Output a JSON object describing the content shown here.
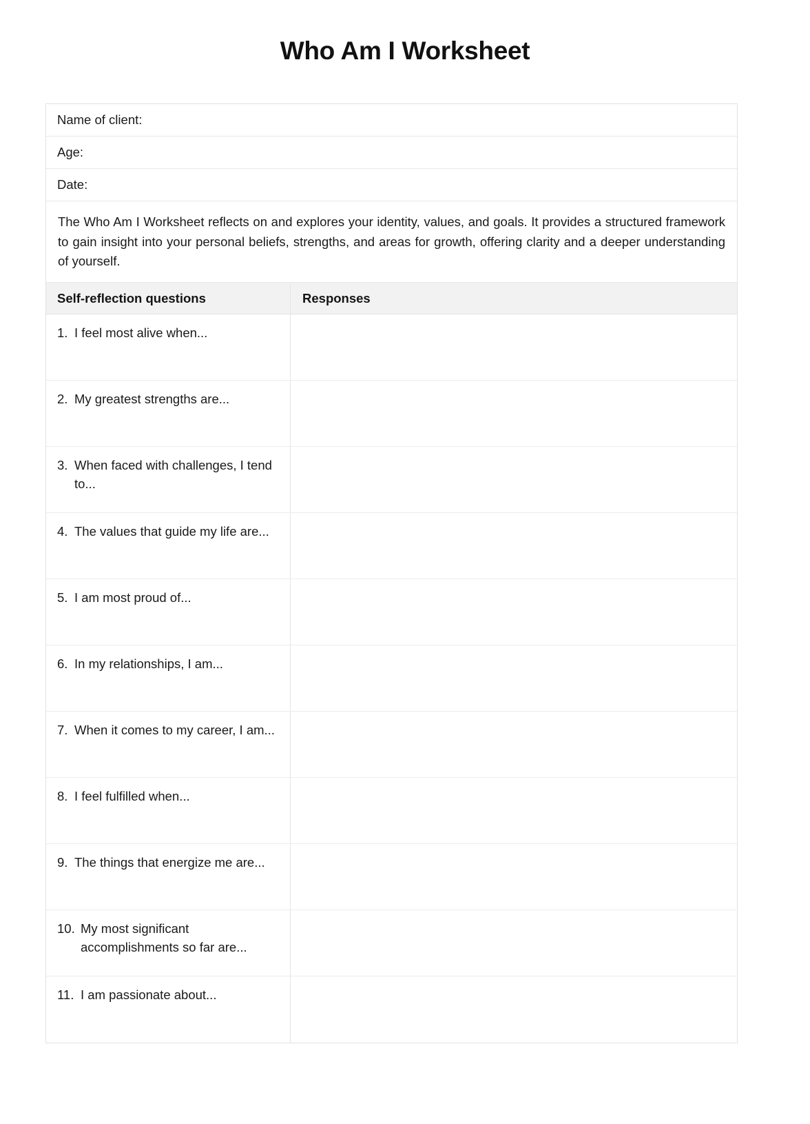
{
  "document": {
    "title": "Who Am I Worksheet"
  },
  "meta_fields": [
    {
      "label": "Name of client:",
      "value": ""
    },
    {
      "label": "Age:",
      "value": ""
    },
    {
      "label": "Date:",
      "value": ""
    }
  ],
  "intro": {
    "text": "The Who Am I Worksheet reflects on and explores your identity, values, and goals. It provides a structured framework to gain insight into your personal beliefs, strengths, and areas for growth, offering clarity and a deeper understanding of yourself."
  },
  "table": {
    "headers": {
      "questions": "Self-reflection questions",
      "responses": "Responses"
    },
    "rows": [
      {
        "number": "1.",
        "question": "I feel most alive when...",
        "response": ""
      },
      {
        "number": "2.",
        "question": "My greatest strengths are...",
        "response": ""
      },
      {
        "number": "3.",
        "question": "When faced with challenges, I tend to...",
        "response": ""
      },
      {
        "number": "4.",
        "question": "The values that guide my life are...",
        "response": ""
      },
      {
        "number": "5.",
        "question": "I am most proud of...",
        "response": ""
      },
      {
        "number": "6.",
        "question": "In my relationships, I am...",
        "response": ""
      },
      {
        "number": "7.",
        "question": "When it comes to my career, I am...",
        "response": ""
      },
      {
        "number": "8.",
        "question": "I feel fulfilled when...",
        "response": ""
      },
      {
        "number": "9.",
        "question": "The things that energize me are...",
        "response": ""
      },
      {
        "number": "10.",
        "question": "My most significant accomplishments so far are...",
        "response": ""
      },
      {
        "number": "11.",
        "question": "I am passionate about...",
        "response": ""
      }
    ]
  },
  "colors": {
    "page_background": "#ffffff",
    "text": "#1a1a1a",
    "border": "#e5e5e5",
    "header_row_background": "#f2f2f2"
  }
}
